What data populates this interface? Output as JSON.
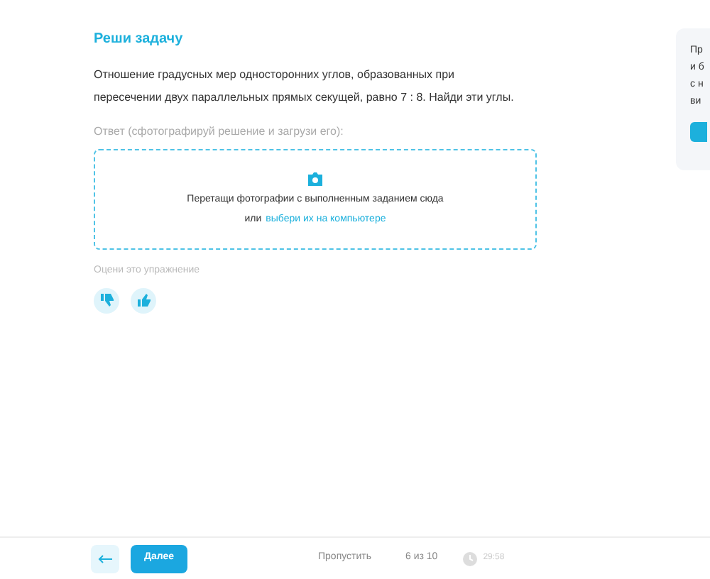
{
  "task": {
    "title": "Реши задачу",
    "text": "Отношение градусных мер односторонних углов, образованных при пересечении двух параллельных прямых секущей, равно 7 : 8. Найди эти углы."
  },
  "answer": {
    "label": "Ответ (сфотографируй решение и загрузи его):",
    "upload_text": "Перетащи фотографии с выполненным заданием сюда",
    "upload_or": "или",
    "upload_link": "выбери их на компьютере"
  },
  "rating": {
    "label": "Оцени это упражнение"
  },
  "side_card": {
    "lines": [
      "Пр",
      "и б",
      "с н",
      "ви"
    ]
  },
  "footer": {
    "next": "Далее",
    "skip": "Пропустить",
    "progress": "6 из 10",
    "time": "29:58"
  }
}
